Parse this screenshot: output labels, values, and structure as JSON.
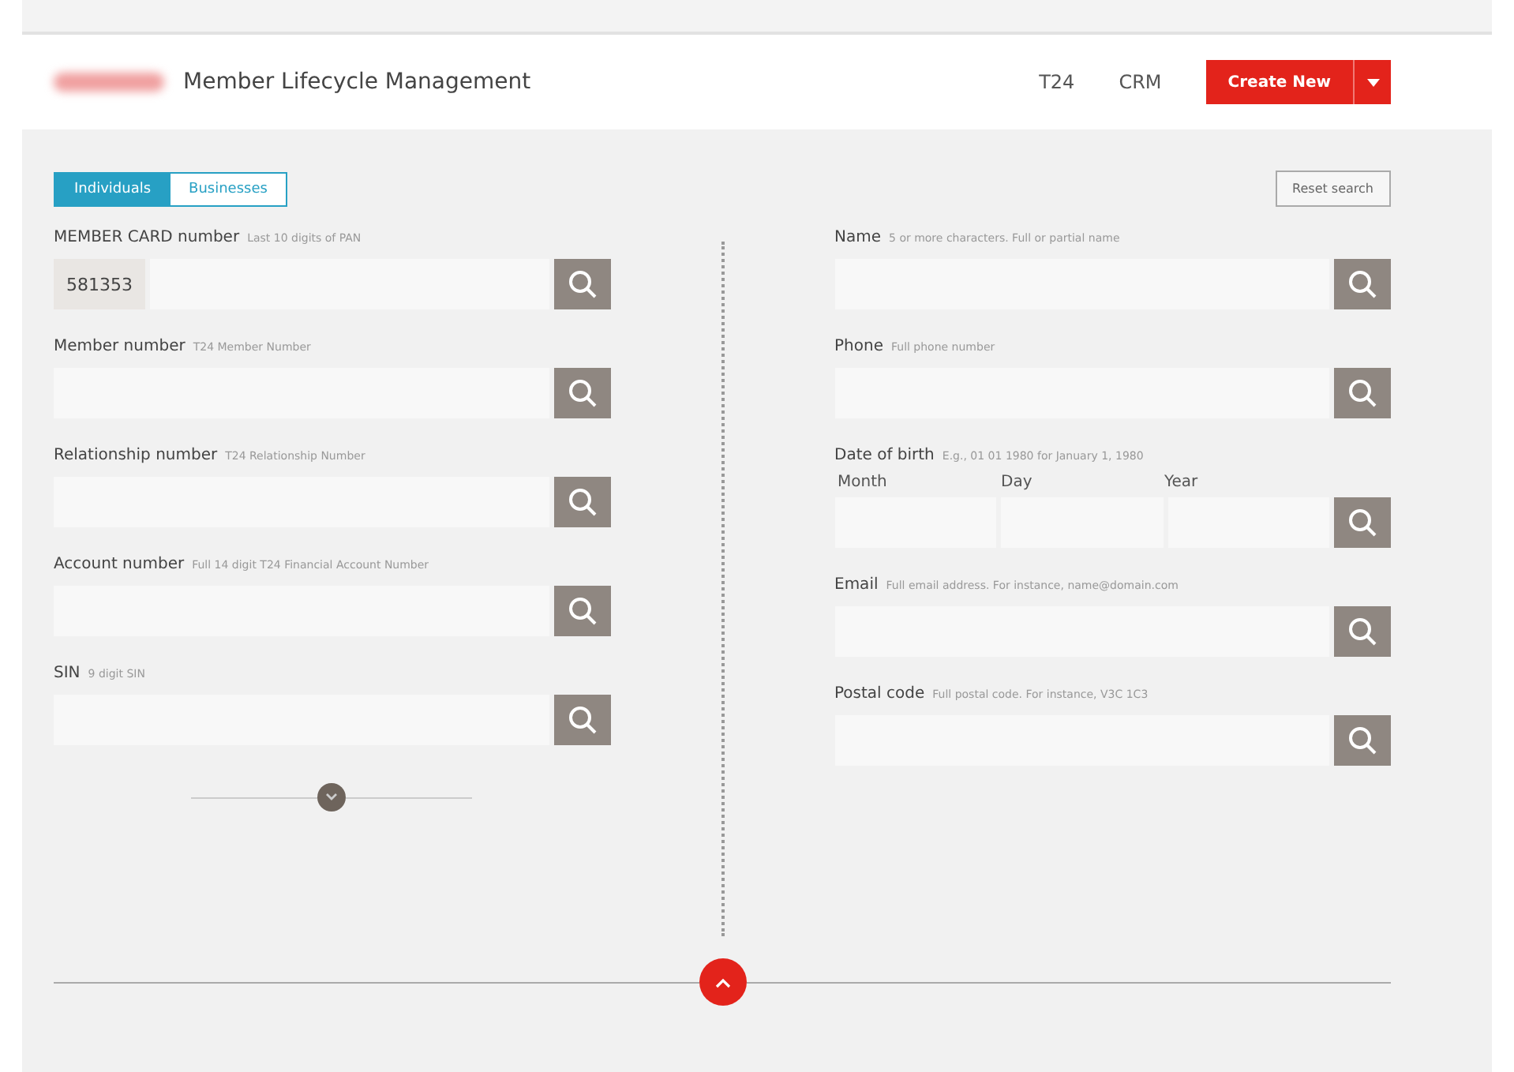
{
  "header": {
    "title": "Member Lifecycle Management",
    "nav": [
      "T24",
      "CRM"
    ],
    "create_button": "Create New"
  },
  "toggle": [
    {
      "label": "Individuals",
      "selected": true
    },
    {
      "label": "Businesses",
      "selected": false
    }
  ],
  "reset_button": "Reset search",
  "left_fields": [
    {
      "kind": "text",
      "label": "MEMBER CARD number",
      "hint": "Last 10 digits of PAN",
      "prefix": "581353"
    },
    {
      "kind": "text",
      "label": "Member number",
      "hint": "T24 Member Number"
    },
    {
      "kind": "text",
      "label": "Relationship number",
      "hint": "T24 Relationship Number"
    },
    {
      "kind": "text",
      "label": "Account number",
      "hint": "Full 14 digit T24 Financial Account Number"
    },
    {
      "kind": "text",
      "label": "SIN",
      "hint": "9 digit SIN"
    }
  ],
  "right_fields": [
    {
      "kind": "text",
      "label": "Name",
      "hint": "5 or more characters. Full or partial name"
    },
    {
      "kind": "text",
      "label": "Phone",
      "hint": "Full phone number"
    },
    {
      "kind": "date",
      "label": "Date of birth",
      "hint": "E.g., 01 01 1980 for January 1, 1980",
      "parts": [
        "Month",
        "Day",
        "Year"
      ]
    },
    {
      "kind": "text",
      "label": "Email",
      "hint": "Full email address. For instance, name@domain.com"
    },
    {
      "kind": "text",
      "label": "Postal code",
      "hint": "Full postal code. For instance, V3C 1C3"
    }
  ]
}
